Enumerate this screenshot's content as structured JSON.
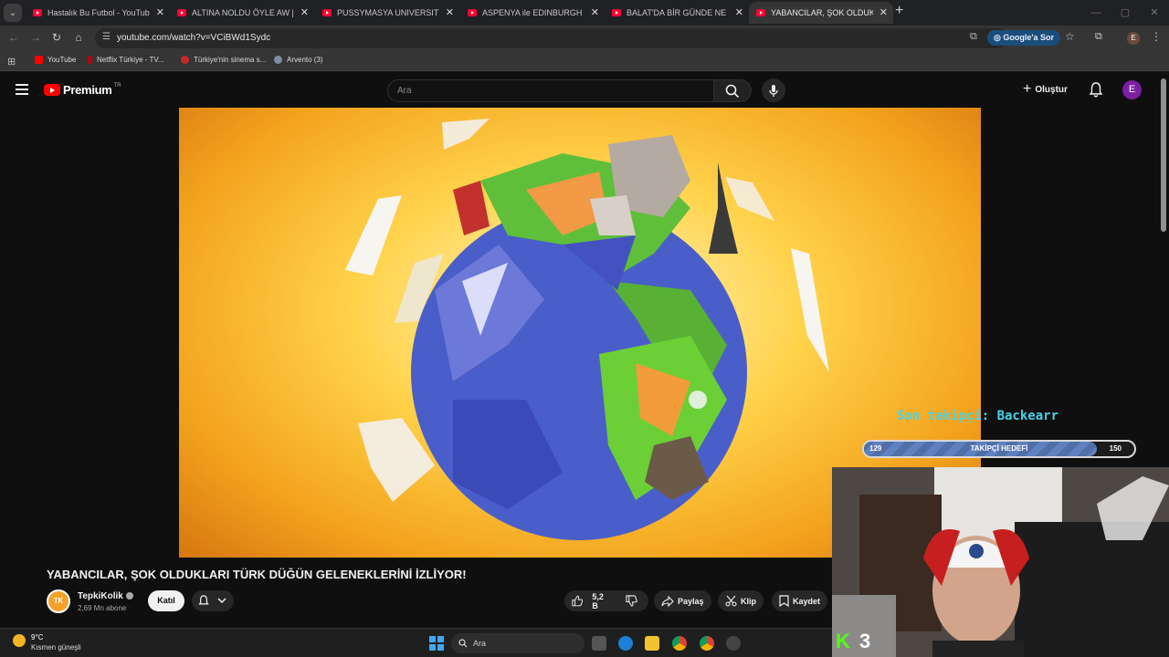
{
  "browser": {
    "tabs": [
      {
        "title": "Hastalık Bu Futbol - YouTube",
        "active": false
      },
      {
        "title": "ALTINA NOLDU ÖYLE AW | Kam",
        "active": false
      },
      {
        "title": "PUSSYMASYA UNIVERSITY | Ma",
        "active": false
      },
      {
        "title": "ASPENYA ile EDINBURGH YEME",
        "active": false
      },
      {
        "title": "BALAT'DA BİR GÜNDE NE YENİ",
        "active": false
      },
      {
        "title": "YABANCILAR, ŞOK OLDUKLARI",
        "active": true
      }
    ],
    "tab_close": "✕",
    "new_tab": "+",
    "url": "youtube.com/watch?v=VCiBWd1Sydc",
    "google_ask": "Google'a Sor",
    "profile_initial": "E",
    "bookmarks": [
      "YouTube",
      "Netflix Türkiye - TV...",
      "Türkiye'nin sinema s...",
      "Arvento (3)"
    ]
  },
  "youtube": {
    "logo_text": "Premium",
    "region": "TR",
    "search_placeholder": "Ara",
    "create_label": "Oluştur",
    "avatar_initial": "E"
  },
  "stream_overlay": {
    "last_follower": "Son takipçi: Backearr",
    "goal_current": "129",
    "goal_label": "TAKİPÇİ HEDEFİ",
    "goal_target": "150",
    "goal_fraction": 0.86
  },
  "video": {
    "title": "YABANCILAR, ŞOK OLDUKLARI TÜRK DÜĞÜN GELENEKLERİNİ İZLİYOR!",
    "channel_name": "TepkiKolik",
    "channel_logo_text": "TK",
    "subscribers": "2,69 Mn abone",
    "join_label": "Katıl",
    "likes": "5,2 B",
    "share_label": "Paylaş",
    "clip_label": "Klip",
    "save_label": "Kaydet"
  },
  "taskbar": {
    "temperature": "9°C",
    "weather": "Kısmen güneşli",
    "search_placeholder": "Ara",
    "kick_count": "3"
  },
  "colors": {
    "accent_red": "#ff0000",
    "overlay_cyan": "#49d2e8",
    "avatar_purple": "#7b1fa2"
  }
}
